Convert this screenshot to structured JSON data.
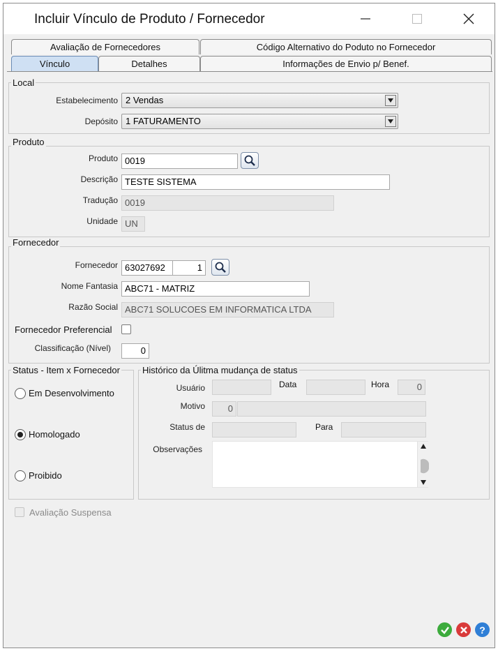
{
  "window": {
    "title": "Incluir Vínculo de Produto / Fornecedor"
  },
  "tabs": {
    "row1": [
      {
        "label": "Avaliação de Fornecedores"
      },
      {
        "label": "Código Alternativo do Poduto no Fornecedor"
      }
    ],
    "row2": [
      {
        "label": "Vínculo",
        "active": true
      },
      {
        "label": "Detalhes"
      },
      {
        "label": "Informações de Envio p/ Benef."
      }
    ]
  },
  "local": {
    "title": "Local",
    "estabelecimento_label": "Estabelecimento",
    "estabelecimento_value": "2 Vendas",
    "deposito_label": "Depósito",
    "deposito_value": "1 FATURAMENTO"
  },
  "produto": {
    "title": "Produto",
    "produto_label": "Produto",
    "produto_value": "0019",
    "descricao_label": "Descrição",
    "descricao_value": "TESTE SISTEMA",
    "traducao_label": "Tradução",
    "traducao_value": "0019",
    "unidade_label": "Unidade",
    "unidade_value": "UN"
  },
  "fornecedor": {
    "title": "Fornecedor",
    "fornecedor_label": "Fornecedor",
    "fornecedor_code": "63027692",
    "fornecedor_seq": "1",
    "nome_fantasia_label": "Nome Fantasia",
    "nome_fantasia_value": "ABC71 - MATRIZ",
    "razao_social_label": "Razão Social",
    "razao_social_value": "ABC71 SOLUCOES EM INFORMATICA LTDA",
    "preferencial_label": "Fornecedor Preferencial",
    "preferencial_checked": false,
    "classificacao_label": "Classificação (Nível)",
    "classificacao_value": "0"
  },
  "status": {
    "title": "Status - Item x Fornecedor",
    "options": [
      {
        "label": "Em Desenvolvimento",
        "selected": false
      },
      {
        "label": "Homologado",
        "selected": true
      },
      {
        "label": "Proibido",
        "selected": false
      }
    ]
  },
  "historico": {
    "title": "Histórico da Úlitma mudança de status",
    "usuario_label": "Usuário",
    "usuario_value": "",
    "data_label": "Data",
    "data_value": "",
    "hora_label": "Hora",
    "hora_value": "0",
    "motivo_label": "Motivo",
    "motivo_code": "0",
    "motivo_desc": "",
    "status_de_label": "Status de",
    "status_de_value": "",
    "para_label": "Para",
    "para_value": "",
    "observacoes_label": "Observações",
    "observacoes_value": ""
  },
  "avaliacao_suspensa": {
    "label": "Avaliação Suspensa",
    "checked": false
  },
  "icons": {
    "lookup": "magnifier-icon",
    "confirm": "check-icon",
    "cancel": "cancel-icon",
    "help": "help-icon"
  },
  "colors": {
    "active_tab": "#cfe0f3",
    "confirm": "#3cab3c",
    "cancel": "#d93a3a",
    "help": "#2f7fd6"
  }
}
